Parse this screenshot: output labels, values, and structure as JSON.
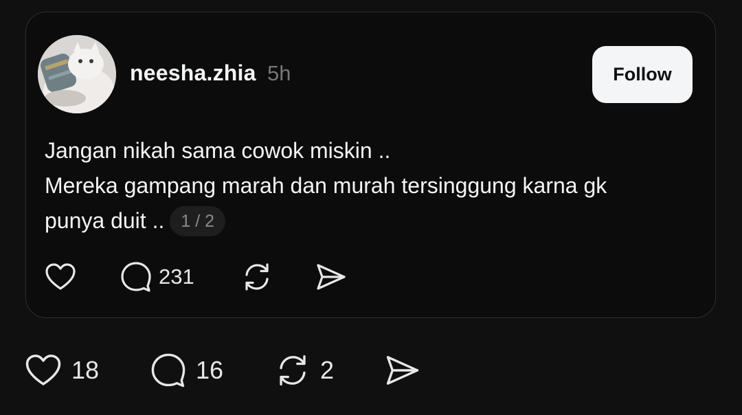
{
  "post": {
    "username": "neesha.zhia",
    "timestamp": "5h",
    "follow_label": "Follow",
    "text_lines": [
      "Jangan nikah sama cowok miskin ..",
      "Mereka gampang marah dan murah tersinggung karna gk",
      "punya duit .."
    ],
    "page_indicator": "1 / 2",
    "actions": {
      "like_icon": "heart-icon",
      "comment_icon": "comment-icon",
      "comment_count": "231",
      "repost_icon": "repost-icon",
      "share_icon": "share-icon"
    }
  },
  "outer_actions": {
    "like_icon": "heart-icon",
    "like_count": "18",
    "comment_icon": "comment-icon",
    "comment_count": "16",
    "repost_icon": "repost-icon",
    "repost_count": "2",
    "share_icon": "share-icon"
  },
  "colors": {
    "background": "#101010",
    "text": "#f3f5f7",
    "muted": "#777777",
    "button_bg": "#f3f5f7",
    "border": "#2e2e2e"
  }
}
